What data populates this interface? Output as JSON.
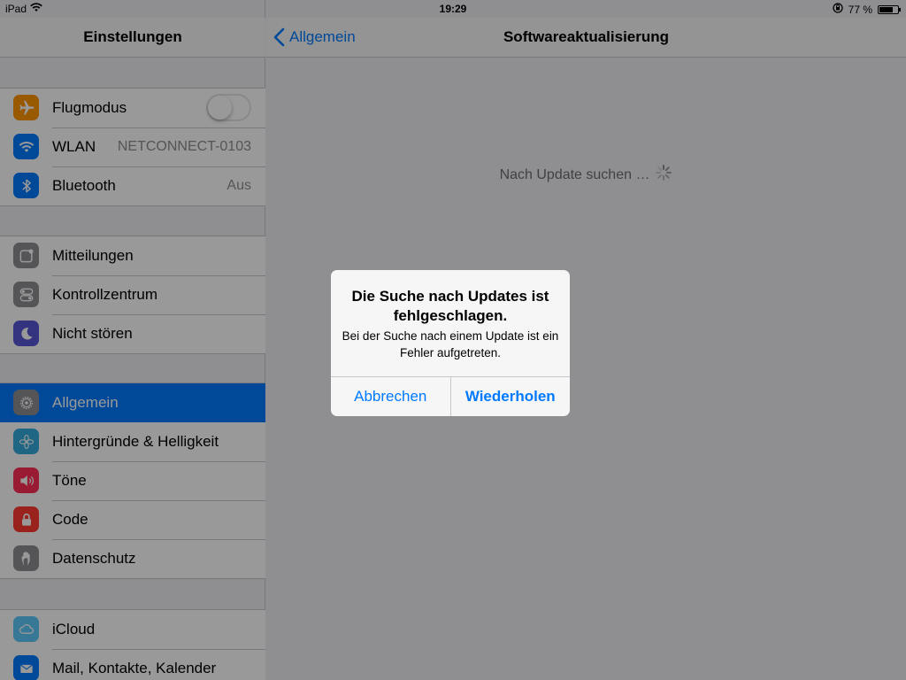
{
  "statusbar": {
    "device": "iPad",
    "time": "19:29",
    "battery": "77 %",
    "battery_level": 0.77
  },
  "sidebar": {
    "title": "Einstellungen",
    "groups": [
      {
        "items": [
          {
            "label": "Flugmodus",
            "icon": "airplane-icon",
            "color": "#ff9500",
            "toggle": false
          },
          {
            "label": "WLAN",
            "icon": "wifi-icon",
            "color": "#007aff",
            "value": "NETCONNECT-0103"
          },
          {
            "label": "Bluetooth",
            "icon": "bluetooth-icon",
            "color": "#007aff",
            "value": "Aus"
          }
        ]
      },
      {
        "items": [
          {
            "label": "Mitteilungen",
            "icon": "notifications-icon",
            "color": "#8e8e93"
          },
          {
            "label": "Kontrollzentrum",
            "icon": "control-center-icon",
            "color": "#8e8e93"
          },
          {
            "label": "Nicht stören",
            "icon": "moon-icon",
            "color": "#5856d6"
          }
        ]
      },
      {
        "items": [
          {
            "label": "Allgemein",
            "icon": "gear-icon",
            "color": "#8e8e93",
            "selected": true
          },
          {
            "label": "Hintergründe & Helligkeit",
            "icon": "flower-icon",
            "color": "#34aadc"
          },
          {
            "label": "Töne",
            "icon": "speaker-icon",
            "color": "#ff2d55"
          },
          {
            "label": "Code",
            "icon": "lock-icon",
            "color": "#ff3b30"
          },
          {
            "label": "Datenschutz",
            "icon": "hand-icon",
            "color": "#8e8e93"
          }
        ]
      },
      {
        "items": [
          {
            "label": "iCloud",
            "icon": "cloud-icon",
            "color": "#5ac8fa"
          },
          {
            "label": "Mail, Kontakte, Kalender",
            "icon": "mail-icon",
            "color": "#007aff"
          }
        ]
      }
    ]
  },
  "main": {
    "back_label": "Allgemein",
    "title": "Softwareaktualisierung",
    "status_text": "Nach Update suchen …"
  },
  "alert": {
    "title": "Die Suche nach Updates ist fehlgeschlagen.",
    "message": "Bei der Suche nach einem Update ist ein Fehler aufgetreten.",
    "cancel_label": "Abbrechen",
    "retry_label": "Wiederholen"
  }
}
